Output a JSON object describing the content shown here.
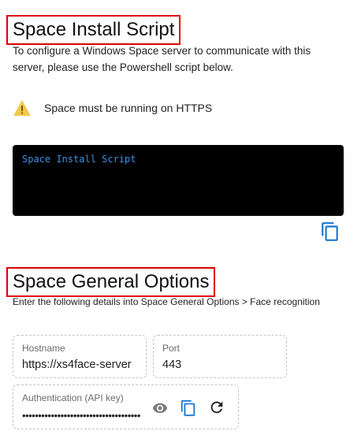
{
  "install_section": {
    "title": "Space Install Script",
    "description": "To configure a Windows Space server to communicate with this server, please use the Powershell script below.",
    "warning": "Space must be running on HTTPS",
    "code_text": "Space Install Script"
  },
  "general_section": {
    "title": "Space General Options",
    "description": "Enter the following details into Space General Options > Face recognition",
    "hostname_label": "Hostname",
    "hostname_value": "https://xs4face-server",
    "port_label": "Port",
    "port_value": "443",
    "api_label": "Authentication (API key)",
    "api_value": "••••••••••••••••••••••••••••••••••••••••"
  },
  "colors": {
    "accent": "#1976d2",
    "warning": "#f2c94c",
    "code_bg": "#000000",
    "code_text": "#3d8fe0",
    "highlight_border": "#e00000"
  },
  "icons": [
    "warning-icon",
    "copy-icon",
    "eye-icon",
    "refresh-icon"
  ]
}
